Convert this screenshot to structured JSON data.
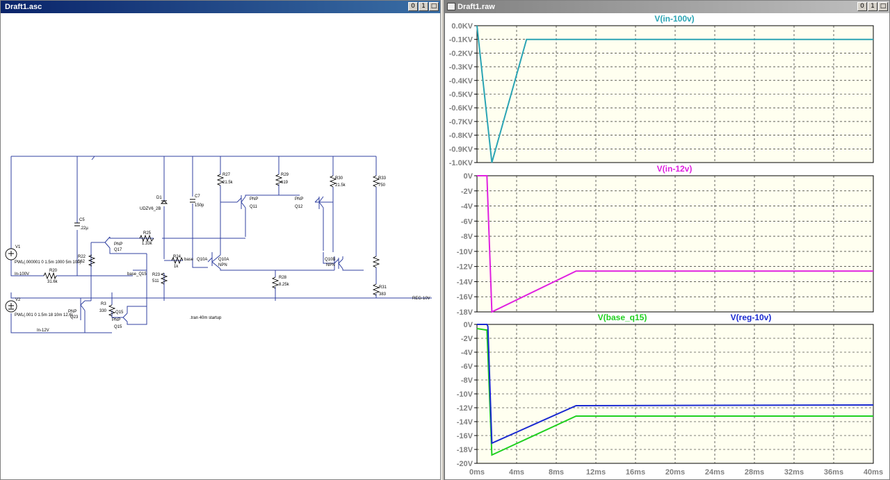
{
  "schematic_window": {
    "title": "Draft1.asc",
    "buttons": [
      "0",
      "1",
      "□"
    ]
  },
  "waveform_window": {
    "title": "Draft1.raw",
    "buttons": [
      "0",
      "1",
      "□"
    ]
  },
  "schematic": {
    "labels": {
      "v1": "V1",
      "v1_spec": "PWL(.000001 0 1.5m 1000 5m 100)",
      "v2": "V2",
      "v2_spec": "PWL(.001 0 1.5m 18 10m 12.6)",
      "in100": "In-100V",
      "in12": "In-12V",
      "r20": "R20",
      "r20v": "31.6k",
      "r22": "R22",
      "r22v": "162",
      "c5": "C5",
      "c5v": ".22µ",
      "r25": "R25",
      "r25v": "1.33k",
      "q17a": "PNP",
      "q17": "Q17",
      "d1": "D1",
      "d1v": "UDZV6_2B",
      "c7": "C7",
      "c7v": "150p",
      "r24": "R24",
      "r24v": "1k",
      "r23": "R23",
      "r23v": "511",
      "base_net": "base",
      "base_q15": "base_Q15",
      "r27": "R27",
      "r27v": "21.5k",
      "r29": "R29",
      "r29v": "619",
      "r30": "R30",
      "r30v": "21.5k",
      "r33": "R33",
      "r33v": "750",
      "q11a": "PNP",
      "q11": "Q11",
      "q12a": "PNP",
      "q12": "Q12",
      "q10a": "Q10A",
      "q10at": "NPN",
      "q10b": "Q10B",
      "q10bt": "NPN",
      "r28": "R28",
      "r28v": "8.25k",
      "r31": "R31",
      "r31v": "383",
      "reg": "REG-10V",
      "r3": "R3",
      "r3v": "330",
      "q15top": "Q15",
      "q23a": "PNP",
      "q23": "Q23",
      "q15a": "PNP",
      "q15": "Q15",
      "tran": ".tran 40m startup"
    }
  },
  "plots": {
    "x_ticks": [
      "0ms",
      "4ms",
      "8ms",
      "12ms",
      "16ms",
      "20ms",
      "24ms",
      "28ms",
      "32ms",
      "36ms",
      "40ms"
    ],
    "panes": [
      {
        "y_ticks": [
          "0.0KV",
          "-0.1KV",
          "-0.2KV",
          "-0.3KV",
          "-0.4KV",
          "-0.5KV",
          "-0.6KV",
          "-0.7KV",
          "-0.8KV",
          "-0.9KV",
          "-1.0KV"
        ],
        "traces": [
          {
            "label": "V(in-100v)",
            "color": "#2aa4b4"
          }
        ]
      },
      {
        "y_ticks": [
          "0V",
          "-2V",
          "-4V",
          "-6V",
          "-8V",
          "-10V",
          "-12V",
          "-14V",
          "-16V",
          "-18V"
        ],
        "traces": [
          {
            "label": "V(in-12v)",
            "color": "#e020e0"
          }
        ]
      },
      {
        "y_ticks": [
          "0V",
          "-2V",
          "-4V",
          "-6V",
          "-8V",
          "-10V",
          "-12V",
          "-14V",
          "-16V",
          "-18V",
          "-20V"
        ],
        "traces": [
          {
            "label": "V(base_q15)",
            "color": "#20d020"
          },
          {
            "label": "V(reg-10v)",
            "color": "#1a2ad0"
          }
        ]
      }
    ]
  },
  "chart_data": [
    {
      "type": "line",
      "title": "",
      "xlabel": "",
      "ylabel": "",
      "xlim": [
        0,
        40
      ],
      "ylim": [
        -1.0,
        0.0
      ],
      "grid": true,
      "series": [
        {
          "name": "V(in-100v)",
          "x": [
            0,
            0.0001,
            1.5,
            5,
            40
          ],
          "y": [
            0,
            0,
            -1.0,
            -0.1,
            -0.1
          ]
        }
      ]
    },
    {
      "type": "line",
      "title": "",
      "xlabel": "",
      "ylabel": "",
      "xlim": [
        0,
        40
      ],
      "ylim": [
        -18,
        0
      ],
      "grid": true,
      "series": [
        {
          "name": "V(in-12v)",
          "x": [
            0,
            1,
            1.5,
            10,
            40
          ],
          "y": [
            0,
            0,
            -18,
            -12.6,
            -12.6
          ]
        }
      ]
    },
    {
      "type": "line",
      "title": "",
      "xlabel": "",
      "ylabel": "",
      "xlim": [
        0,
        40
      ],
      "ylim": [
        -20,
        0
      ],
      "grid": true,
      "series": [
        {
          "name": "V(base_q15)",
          "x": [
            0,
            0.9,
            1.0,
            1.5,
            10,
            40
          ],
          "y": [
            -0.6,
            -0.8,
            -0.8,
            -18.8,
            -13.2,
            -13.2
          ]
        },
        {
          "name": "V(reg-10v)",
          "x": [
            0,
            1.0,
            1.1,
            1.5,
            10,
            40
          ],
          "y": [
            0,
            0,
            -0.3,
            -17.1,
            -11.7,
            -11.6
          ]
        }
      ]
    }
  ]
}
